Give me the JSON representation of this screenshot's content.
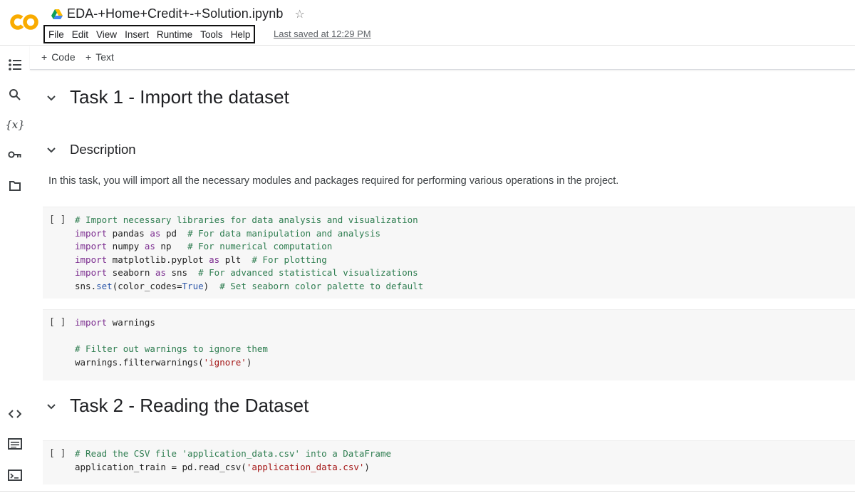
{
  "app": {
    "logo_text": "CO",
    "notebook_title": "EDA-+Home+Credit+-+Solution.ipynb",
    "last_saved": "Last saved at 12:29 PM"
  },
  "menu": [
    "File",
    "Edit",
    "View",
    "Insert",
    "Runtime",
    "Tools",
    "Help"
  ],
  "toolbar": {
    "add_code_label": "Code",
    "add_text_label": "Text"
  },
  "sidebar": {
    "variables_label": "{x}"
  },
  "notebook": {
    "task1_title": "Task 1 - Import the dataset",
    "description_title": "Description",
    "description_text": "In this task, you will import all the necessary modules and packages required for performing various operations in the project.",
    "cell_bracket": "[ ]",
    "cell1_lines": [
      "# Import necessary libraries for data analysis and visualization",
      "import pandas as pd  # For data manipulation and analysis",
      "import numpy as np   # For numerical computation",
      "import matplotlib.pyplot as plt  # For plotting",
      "import seaborn as sns  # For advanced statistical visualizations",
      "sns.set(color_codes=True)  # Set seaborn color palette to default"
    ],
    "cell2_lines": [
      "import warnings",
      "",
      "# Filter out warnings to ignore them",
      "warnings.filterwarnings('ignore')"
    ],
    "task2_title": "Task 2 - Reading the Dataset",
    "cell3_lines": [
      "# Read the CSV file 'application_data.csv' into a DataFrame",
      "application_train = pd.read_csv('application_data.csv')"
    ]
  },
  "colors": {
    "logo_orange": "#F9AB00",
    "keyword": "#7b2c8f",
    "comment": "#2e7d50",
    "string": "#a31515",
    "builtin": "#2a55a8",
    "cell_bg": "#f7f7f7"
  }
}
